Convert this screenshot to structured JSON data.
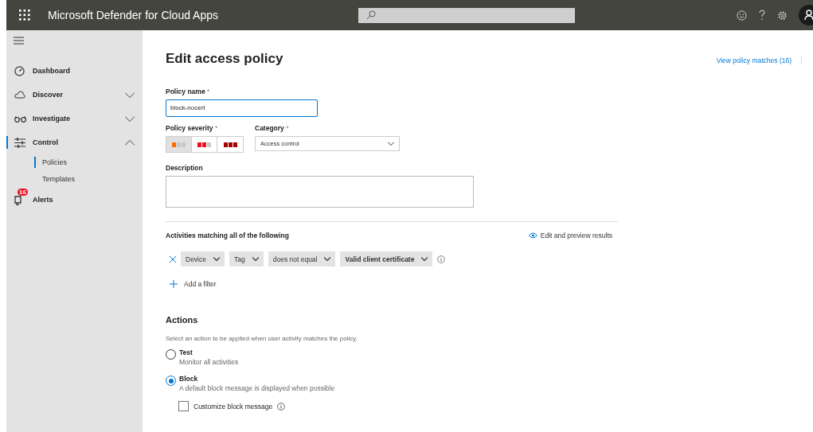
{
  "app_bar": {
    "title": "Microsoft Defender for Cloud Apps"
  },
  "sidebar": {
    "items": [
      {
        "label": "Dashboard"
      },
      {
        "label": "Discover",
        "expanded": false
      },
      {
        "label": "Investigate",
        "expanded": false
      },
      {
        "label": "Control",
        "expanded": true,
        "children": [
          {
            "label": "Policies",
            "selected": true
          },
          {
            "label": "Templates",
            "selected": false
          }
        ]
      },
      {
        "label": "Alerts",
        "badge": "16"
      }
    ]
  },
  "page": {
    "title": "Edit access policy",
    "view_matches_link": "View policy matches (16)"
  },
  "form": {
    "policy_name": {
      "label": "Policy name",
      "required_mark": "*",
      "value": "block-nocert"
    },
    "severity": {
      "label": "Policy severity",
      "required_mark": "*",
      "options": [
        {
          "kind": "low",
          "selected": true
        },
        {
          "kind": "medium",
          "selected": false
        },
        {
          "kind": "high",
          "selected": false
        }
      ]
    },
    "category": {
      "label": "Category",
      "required_mark": "*",
      "value": "Access control"
    },
    "description": {
      "label": "Description"
    }
  },
  "filters": {
    "heading": "Activities matching all of the following",
    "preview_link": "Edit and preview results",
    "rows": [
      {
        "dropdowns": [
          {
            "text": "Device",
            "bold": false
          },
          {
            "text": "Tag",
            "bold": false
          },
          {
            "text": "does not equal",
            "bold": false
          },
          {
            "text": "Valid client certificate",
            "bold": true
          }
        ]
      }
    ],
    "add_filter": "Add a filter"
  },
  "actions": {
    "heading": "Actions",
    "hint": "Select an action to be applied when user activity matches the policy.",
    "options": [
      {
        "label": "Test",
        "description": "Monitor all activities",
        "selected": false
      },
      {
        "label": "Block",
        "description": "A default block message is displayed when possible",
        "selected": true
      }
    ],
    "customize": {
      "label": "Customize block message",
      "checked": false
    }
  }
}
